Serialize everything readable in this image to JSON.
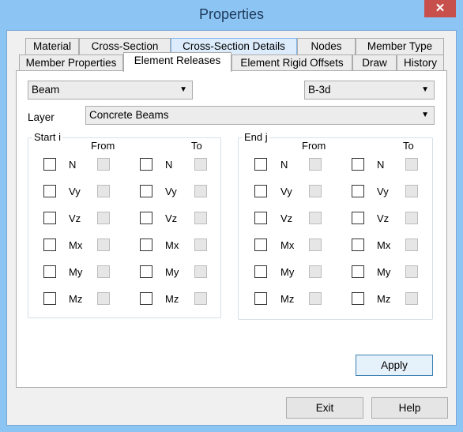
{
  "window": {
    "title": "Properties",
    "close_icon": "close-icon"
  },
  "tabs_row1": [
    "Material",
    "Cross-Section",
    "Cross-Section Details",
    "Nodes",
    "Member Type"
  ],
  "tabs_row2": [
    "Member Properties",
    "Element Releases",
    "Element Rigid Offsets",
    "Draw",
    "History"
  ],
  "active_tab": "Element Releases",
  "type_combo": {
    "value": "Beam"
  },
  "section_combo": {
    "value": "B-3d"
  },
  "layer": {
    "label": "Layer",
    "value": "Concrete Beams"
  },
  "start_group": {
    "title": "Start i",
    "from_label": "From",
    "to_label": "To"
  },
  "end_group": {
    "title": "End j",
    "from_label": "From",
    "to_label": "To"
  },
  "releases": [
    "N",
    "Vy",
    "Vz",
    "Mx",
    "My",
    "Mz"
  ],
  "buttons": {
    "apply": "Apply",
    "exit": "Exit",
    "help": "Help"
  }
}
